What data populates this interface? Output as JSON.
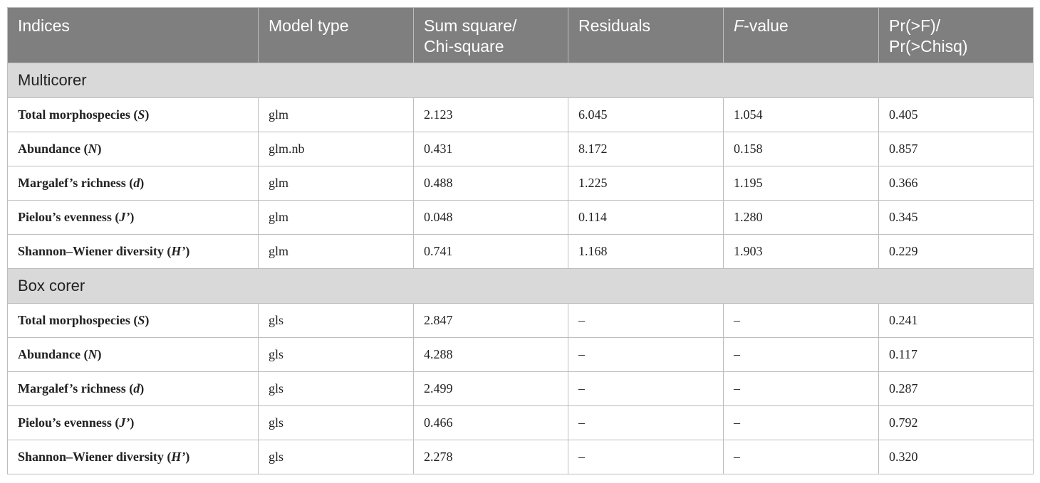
{
  "header": {
    "indices": "Indices",
    "model_type": "Model type",
    "sum_square_line1": "Sum square/",
    "sum_square_line2": "Chi-square",
    "residuals": "Residuals",
    "f_value_italic": "F",
    "f_value_rest": "-value",
    "pr_line1": "Pr(>F)/",
    "pr_line2": "Pr(>Chisq)"
  },
  "sections": [
    {
      "title": "Multicorer",
      "rows": [
        {
          "index": "Total morphospecies (",
          "symbol": "S",
          "close": ")",
          "model": "glm",
          "sum_sq": "2.123",
          "residuals": "6.045",
          "f_value": "1.054",
          "pr": "0.405"
        },
        {
          "index": "Abundance (",
          "symbol": "N",
          "close": ")",
          "model": "glm.nb",
          "sum_sq": "0.431",
          "residuals": "8.172",
          "f_value": "0.158",
          "pr": "0.857"
        },
        {
          "index": "Margalef’s richness (",
          "symbol": "d",
          "close": ")",
          "model": "glm",
          "sum_sq": "0.488",
          "residuals": "1.225",
          "f_value": "1.195",
          "pr": "0.366"
        },
        {
          "index": "Pielou’s evenness (",
          "symbol": "J’",
          "close": ")",
          "model": "glm",
          "sum_sq": "0.048",
          "residuals": "0.114",
          "f_value": "1.280",
          "pr": "0.345"
        },
        {
          "index": "Shannon–Wiener diversity (",
          "symbol": "H’",
          "close": ")",
          "model": "glm",
          "sum_sq": "0.741",
          "residuals": "1.168",
          "f_value": "1.903",
          "pr": "0.229"
        }
      ]
    },
    {
      "title": "Box corer",
      "rows": [
        {
          "index": "Total morphospecies (",
          "symbol": "S",
          "close": ")",
          "model": "gls",
          "sum_sq": "2.847",
          "residuals": "–",
          "f_value": "–",
          "pr": "0.241"
        },
        {
          "index": "Abundance (",
          "symbol": "N",
          "close": ")",
          "model": "gls",
          "sum_sq": "4.288",
          "residuals": "–",
          "f_value": "–",
          "pr": "0.117"
        },
        {
          "index": "Margalef’s richness (",
          "symbol": "d",
          "close": ")",
          "model": "gls",
          "sum_sq": "2.499",
          "residuals": "–",
          "f_value": "–",
          "pr": "0.287"
        },
        {
          "index": "Pielou’s evenness (",
          "symbol": "J’",
          "close": ")",
          "model": "gls",
          "sum_sq": "0.466",
          "residuals": "–",
          "f_value": "–",
          "pr": "0.792"
        },
        {
          "index": "Shannon–Wiener diversity (",
          "symbol": "H’",
          "close": ")",
          "model": "gls",
          "sum_sq": "2.278",
          "residuals": "–",
          "f_value": "–",
          "pr": "0.320"
        }
      ]
    }
  ]
}
